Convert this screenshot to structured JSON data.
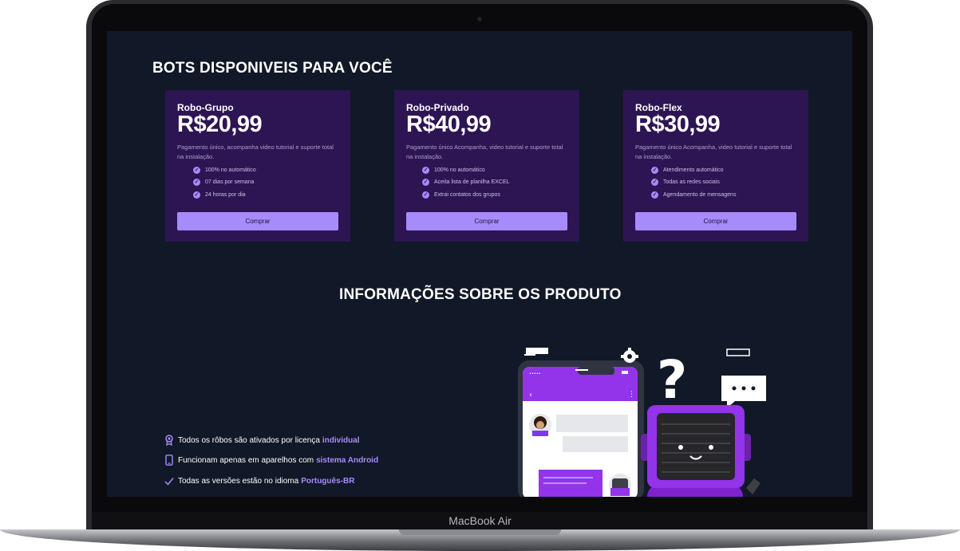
{
  "device": {
    "brand_label": "MacBook Air"
  },
  "page": {
    "bots_title": "BOTS DISPONIVEIS PARA VOCÊ",
    "info_title": "INFORMAÇÕES SOBRE OS PRODUTO"
  },
  "cards": [
    {
      "name": "Robo-Grupo",
      "price": "R$20,99",
      "description": "Pagamento único, acompanha video tutorial e suporte total na instalação.",
      "features": [
        "100% no automático",
        "07 dias por semana",
        "24 horas por dia"
      ],
      "button": "Comprar"
    },
    {
      "name": "Robo-Privado",
      "price": "R$40,99",
      "description": "Pagamento único Acompanha, video tutorial e suporte total na instalação.",
      "features": [
        "100% no automático",
        "Aceita lista de planilha EXCEL",
        "Extrai contatos dos grupos"
      ],
      "button": "Comprar"
    },
    {
      "name": "Robo-Flex",
      "price": "R$30,99",
      "description": "Pagamento único Acompanha, video tutorial e suporte total na instalação.",
      "features": [
        "Atendimento automático",
        "Todas as redes sociais",
        "Agendamento de mensagens"
      ],
      "button": "Comprar"
    }
  ],
  "info_items": [
    {
      "icon": "award-icon",
      "text": "Todos os rôbos são ativados por licença",
      "highlight": "individual"
    },
    {
      "icon": "smartphone-icon",
      "text": "Funcionam apenas em aparelhos com",
      "highlight": "sistema Android"
    },
    {
      "icon": "check-icon",
      "text": "Todas as versões estão no idioma",
      "highlight": "Português-BR"
    }
  ],
  "colors": {
    "screen_bg": "#111827",
    "card_bg": "#2d1554",
    "accent": "#a78bfa",
    "illustration_purple": "#7e22ce"
  }
}
